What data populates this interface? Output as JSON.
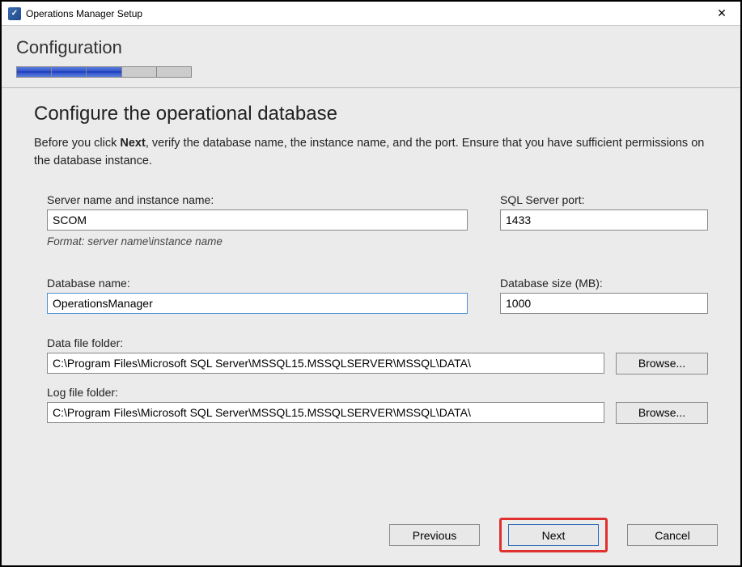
{
  "window": {
    "title": "Operations Manager Setup"
  },
  "header": {
    "label": "Configuration",
    "progress_segments": 5,
    "progress_filled": 3
  },
  "page": {
    "title": "Configure the operational database",
    "desc_prefix": "Before you click ",
    "desc_bold": "Next",
    "desc_suffix": ", verify the database name, the instance name, and the port. Ensure that you have sufficient permissions on the database instance."
  },
  "fields": {
    "server_label": "Server name and instance name:",
    "server_value": "SCOM",
    "server_hint": "Format: server name\\instance name",
    "port_label": "SQL Server port:",
    "port_value": "1433",
    "dbname_label": "Database name:",
    "dbname_value": "OperationsManager",
    "dbsize_label": "Database size (MB):",
    "dbsize_value": "1000",
    "datafolder_label": "Data file folder:",
    "datafolder_value": "C:\\Program Files\\Microsoft SQL Server\\MSSQL15.MSSQLSERVER\\MSSQL\\DATA\\",
    "logfolder_label": "Log file folder:",
    "logfolder_value": "C:\\Program Files\\Microsoft SQL Server\\MSSQL15.MSSQLSERVER\\MSSQL\\DATA\\"
  },
  "buttons": {
    "browse": "Browse...",
    "previous": "Previous",
    "next": "Next",
    "cancel": "Cancel"
  }
}
